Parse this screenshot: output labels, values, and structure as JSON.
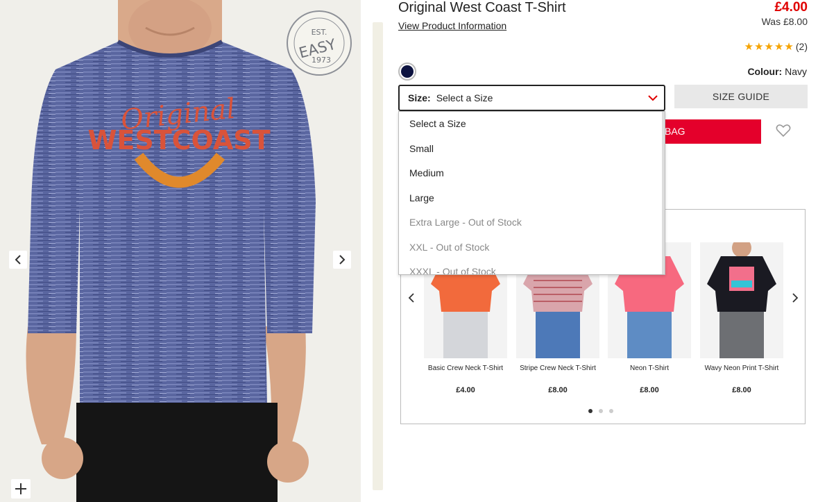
{
  "product": {
    "title": "Original West Coast T-Shirt",
    "info_link": "View Product Information",
    "price": "£4.00",
    "was_price": "Was £8.00",
    "rating_stars": 5,
    "rating_count": "(2)",
    "colour_label": "Colour:",
    "colour_value": "Navy",
    "swatch_color": "#0d1340"
  },
  "gallery": {
    "shirt_print_line1": "Original",
    "shirt_print_line2": "WESTCOAST",
    "badge_top": "EST.",
    "badge_main": "EASY",
    "badge_year": "1973",
    "prev_icon": "chevron-left-icon",
    "next_icon": "chevron-right-icon",
    "zoom_icon": "plus-icon"
  },
  "size": {
    "label": "Size:",
    "selected": "Select a Size",
    "options": [
      {
        "label": "Select a Size",
        "out_of_stock": false
      },
      {
        "label": "Small",
        "out_of_stock": false
      },
      {
        "label": "Medium",
        "out_of_stock": false
      },
      {
        "label": "Large",
        "out_of_stock": false
      },
      {
        "label": "Extra Large - Out of Stock",
        "out_of_stock": true
      },
      {
        "label": "XXL - Out of Stock",
        "out_of_stock": true
      },
      {
        "label": "XXXL - Out of Stock",
        "out_of_stock": true
      }
    ],
    "size_guide": "SIZE GUIDE"
  },
  "actions": {
    "add_to_bag_visible": "BAG",
    "wishlist_icon": "heart-icon"
  },
  "recommendations": {
    "items": [
      {
        "name": "Basic Crew Neck T-Shirt",
        "price": "£4.00",
        "shirt_color": "#f26a3c"
      },
      {
        "name": "Stripe Crew Neck T-Shirt",
        "price": "£8.00",
        "shirt_color": "#d9a5ab"
      },
      {
        "name": "Neon T-Shirt",
        "price": "£8.00",
        "shirt_color": "#f7697f"
      },
      {
        "name": "Wavy Neon Print T-Shirt",
        "price": "£8.00",
        "shirt_color": "#1a1a22"
      }
    ],
    "dots": 3,
    "active_dot": 0
  },
  "colors": {
    "accent_red": "#e4002b",
    "price_red": "#e00000",
    "star": "#f5a300"
  }
}
